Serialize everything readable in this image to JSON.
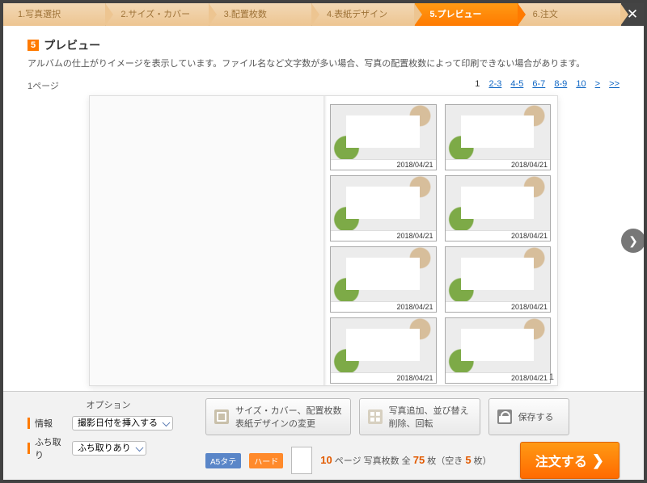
{
  "steps": {
    "s1": "1.写真選択",
    "s2": "2.サイズ・カバー",
    "s3": "3.配置枚数",
    "s4": "4.表紙デザイン",
    "s5": "5.プレビュー",
    "s6": "6.注文"
  },
  "title": {
    "badge": "5",
    "text": "プレビュー",
    "desc": "アルバムの仕上がりイメージを表示しています。ファイル名など文字数が多い場合、写真の配置枚数によって印刷できない場合があります。"
  },
  "pager": {
    "left": "1ページ",
    "current": "1",
    "p2": "2-3",
    "p3": "4-5",
    "p4": "6-7",
    "p5": "8-9",
    "p6": "10",
    "next": ">",
    "last": ">>"
  },
  "photos": {
    "date": "2018/04/21"
  },
  "page_number_right": "1",
  "options": {
    "header": "オプション",
    "info_label": "情報",
    "info_value": "撮影日付を挿入する",
    "border_label": "ふち取り",
    "border_value": "ふち取りあり"
  },
  "buttons": {
    "change": "サイズ・カバー、配置枚数\n表紙デザインの変更",
    "edit": "写真追加、並び替え\n削除、回転",
    "save": "保存する",
    "order": "注文する"
  },
  "info": {
    "tag1": "A5タテ",
    "tag2": "ハード",
    "text_pre": "",
    "pages": "10",
    "pages_label": " ページ 写真枚数 全 ",
    "total": "75",
    "total_label": " 枚（空き ",
    "empty": "5",
    "empty_label": " 枚）"
  }
}
